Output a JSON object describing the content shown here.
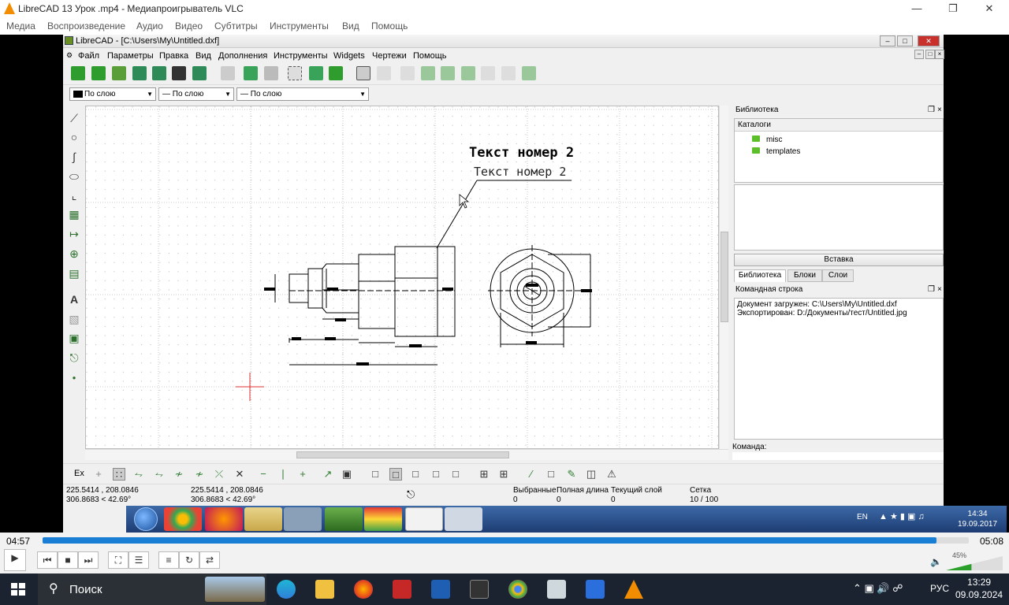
{
  "vlc": {
    "title": "LibreCAD 13 Урок .mp4 - Медиапроигрыватель VLC",
    "menu": [
      "Медиа",
      "Воспроизведение",
      "Аудио",
      "Видео",
      "Субтитры",
      "Инструменты",
      "Вид",
      "Помощь"
    ],
    "time_elapsed": "04:57",
    "time_total": "05:08",
    "progress": 0.965,
    "volume": "45%"
  },
  "librecad": {
    "title": "LibreCAD - [C:\\Users\\My\\Untitled.dxf]",
    "menu": [
      "Файл",
      "Параметры",
      "Правка",
      "Вид",
      "Дополнения",
      "Инструменты",
      "Widgets",
      "Чертежи",
      "Помощь"
    ],
    "props": {
      "color": "По слою",
      "width": "По слою",
      "linetype": "По слою"
    },
    "canvas": {
      "text_bold": "Текст номер 2",
      "text_normal": "Текст номер 2"
    },
    "library": {
      "title": "Библиотека",
      "catalogs_header": "Каталоги",
      "folders": [
        "misc",
        "templates"
      ],
      "insert_button": "Вставка",
      "tabs": [
        "Библиотека",
        "Блоки",
        "Слои"
      ]
    },
    "command": {
      "title": "Командная строка",
      "lines": [
        "Документ загружен: C:\\Users\\My\\Untitled.dxf",
        "Экспортирован: D:/Документы/тест/Untitled.jpg"
      ],
      "prompt": "Команда:"
    },
    "status": {
      "coord_abs_1": "225.5414 , 208.0846",
      "coord_abs_2": "306.8683 < 42.69°",
      "coord_rel_1": "225.5414 , 208.0846",
      "coord_rel_2": "306.8683 < 42.69°",
      "selected_label": "Выбранные",
      "selected_value": "0",
      "length_label": "Полная длина",
      "length_value": "0",
      "layer_label": "Текущий слой",
      "layer_value": "0",
      "grid_label": "Сетка",
      "grid_value": "10 / 100"
    },
    "snap_label": "Ex"
  },
  "win7": {
    "lang": "EN",
    "time": "14:34",
    "date": "19.09.2017"
  },
  "win10": {
    "search": "Поиск",
    "lang": "РУС",
    "time": "13:29",
    "date": "09.09.2024"
  }
}
